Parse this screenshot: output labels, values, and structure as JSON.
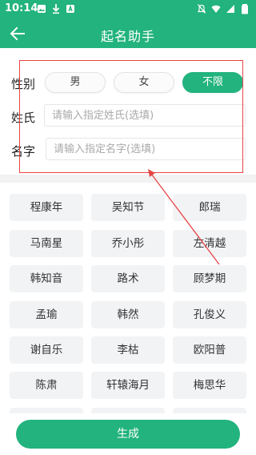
{
  "status_bar": {
    "time": "10:14",
    "left_icons": [
      "image-icon",
      "download-icon",
      "text-icon"
    ],
    "right_icons": [
      "mute-icon",
      "wifi-icon",
      "signal-icon",
      "battery-icon"
    ]
  },
  "header": {
    "title": "起名助手",
    "back_icon": "arrow-left-icon"
  },
  "form": {
    "gender_label": "性别",
    "gender_options": [
      "男",
      "女",
      "不限"
    ],
    "gender_selected": "不限",
    "surname_label": "姓氏",
    "surname_placeholder": "请输入指定姓氏(选填)",
    "surname_value": "",
    "given_name_label": "名字",
    "given_name_placeholder": "请输入指定名字(选填)",
    "given_name_value": ""
  },
  "names": [
    "程康年",
    "吴知节",
    "郎瑞",
    "马南星",
    "乔小彤",
    "左清越",
    "韩知音",
    "路术",
    "顾梦期",
    "孟瑜",
    "韩然",
    "孔俊义",
    "谢自乐",
    "李枯",
    "欧阳普",
    "陈肃",
    "轩辕海月",
    "梅思华"
  ],
  "actions": {
    "generate_label": "生成"
  },
  "colors": {
    "accent": "#22b37e",
    "annotation": "#e54545",
    "chip_bg": "#f2f3f5"
  }
}
